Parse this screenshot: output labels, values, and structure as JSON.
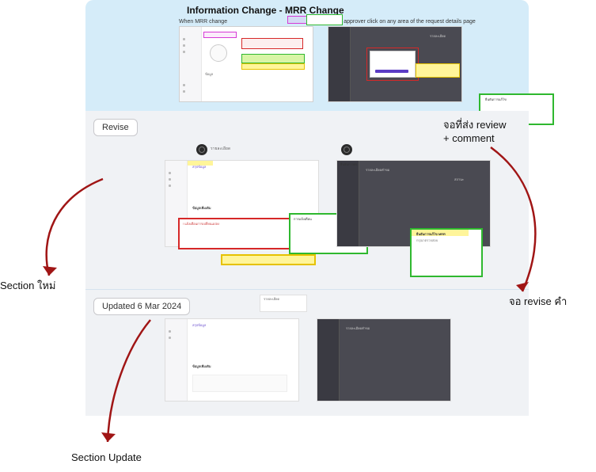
{
  "canvas": {
    "section1": {
      "title": "Information Change - MRR Change",
      "left_caption": "When MRR change",
      "right_caption": "When approver click on any area of the request details page"
    },
    "section2": {
      "chip": "Revise"
    },
    "section3": {
      "chip": "Updated 6 Mar 2024"
    }
  },
  "annotations": {
    "review_comment_line1": "จอที่ส่ง review",
    "review_comment_line2": "+   comment",
    "section_new": "Section ใหม่",
    "revise_screen": "จอ revise คำ",
    "section_update": "Section Update"
  }
}
